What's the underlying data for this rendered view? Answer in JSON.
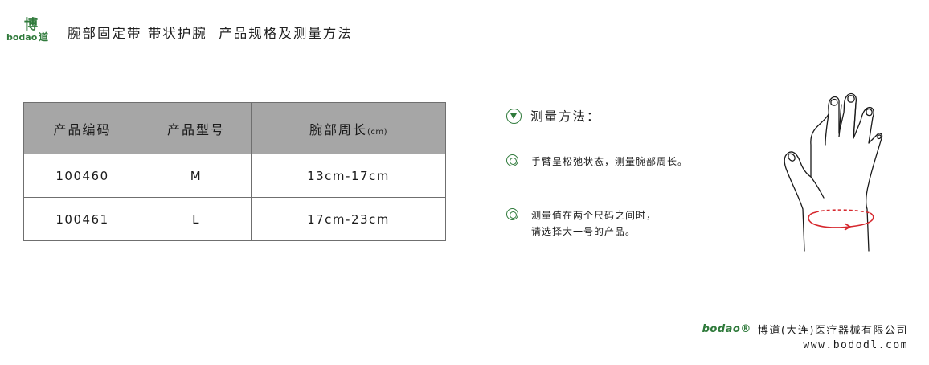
{
  "header": {
    "logo_mark": "博",
    "logo_word": "bodao",
    "logo_char": "道",
    "title": "腕部固定带 带状护腕  产品规格及测量方法"
  },
  "table": {
    "headers": [
      "产品编码",
      "产品型号",
      "腕部周长",
      "(cm)"
    ],
    "rows": [
      [
        "100460",
        "M",
        "13cm-17cm"
      ],
      [
        "100461",
        "L",
        "17cm-23cm"
      ]
    ]
  },
  "method": {
    "title": "测量方法：",
    "steps": [
      {
        "lines": [
          "手臂呈松弛状态，测量腕部周长。"
        ]
      },
      {
        "lines": [
          "测量值在两个尺码之间时，",
          "请选择大一号的产品。"
        ]
      }
    ],
    "icons": [
      "triangle-down-circle-icon",
      "double-ring-icon"
    ],
    "accent_color": "#2f7a3b",
    "arrow_color": "#d6282e"
  },
  "footer": {
    "logo": "bodao®",
    "company": "博道(大连)医疗器械有限公司",
    "website": "www.bododl.com"
  }
}
